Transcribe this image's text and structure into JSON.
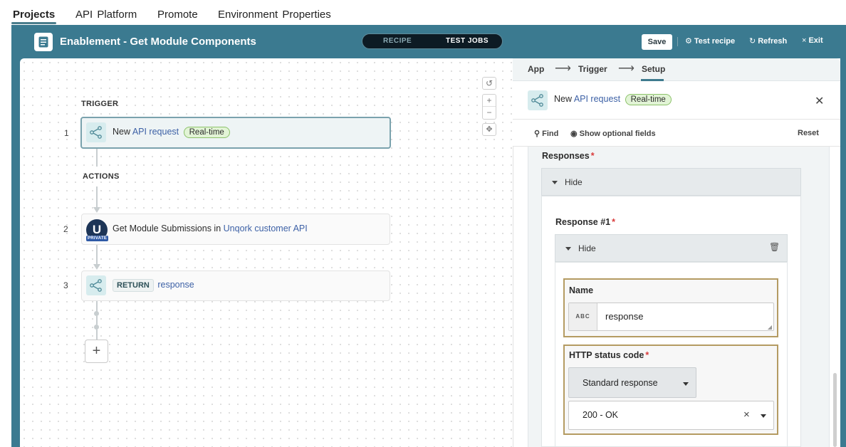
{
  "nav": {
    "items": [
      "Projects",
      "API  Platform",
      "Promote",
      "Environment  Properties"
    ]
  },
  "header": {
    "title": "Enablement - Get Module Components",
    "toggle": {
      "recipe": "RECIPE",
      "test_jobs": "TEST JOBS"
    },
    "save": "Save",
    "test_recipe": "Test recipe",
    "refresh": "Refresh",
    "exit": "Exit"
  },
  "canvas": {
    "trigger_label": "TRIGGER",
    "actions_label": "ACTIONS",
    "steps": [
      {
        "num": "1",
        "prefix": "New",
        "link": "API request",
        "badge": "Real-time"
      },
      {
        "num": "2",
        "prefix": "Get Module Submissions in",
        "link": "Unqork customer API",
        "logo": "U",
        "logo_tag": "PRIVATE"
      },
      {
        "num": "3",
        "tag": "RETURN",
        "link": "response"
      }
    ],
    "add": "+",
    "zoom_in": "+",
    "zoom_out": "−"
  },
  "panel": {
    "breadcrumb": [
      "App",
      "Trigger",
      "Setup"
    ],
    "trigger": {
      "prefix": "New",
      "link": "API request",
      "badge": "Real-time"
    },
    "toolbar": {
      "find": "Find",
      "optional": "Show optional fields",
      "reset": "Reset"
    },
    "form": {
      "responses_label": "Responses",
      "hide": "Hide",
      "response1_label": "Response #1",
      "hide2": "Hide",
      "name_label": "Name",
      "name_type": "ABC",
      "name_value": "response",
      "status_label": "HTTP status code",
      "status_mode": "Standard response",
      "status_value": "200 - OK"
    }
  }
}
